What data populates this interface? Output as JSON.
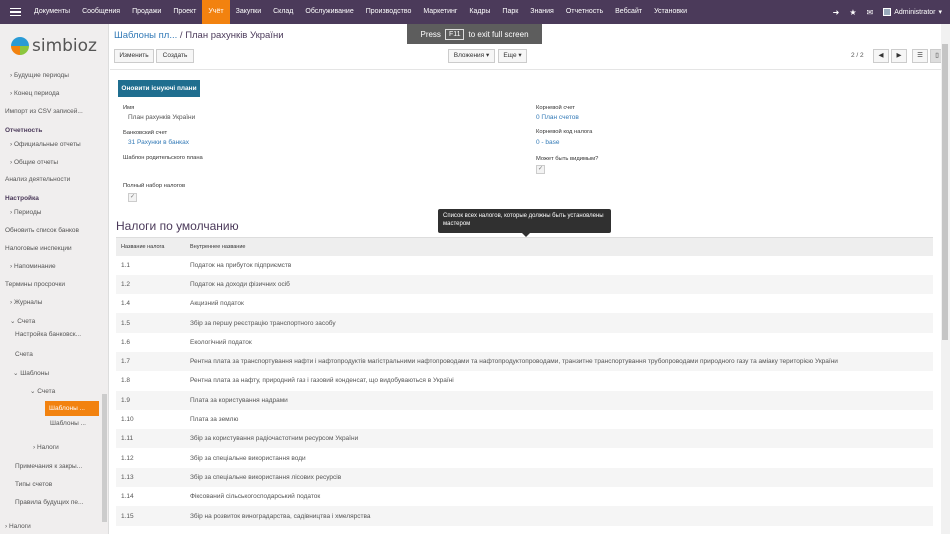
{
  "topbar": {
    "menu": [
      "Документы",
      "Сообщения",
      "Продажи",
      "Проект",
      "Учёт",
      "Закупки",
      "Склад",
      "Обслуживание",
      "Производство",
      "Маркетинг",
      "Кадры",
      "Парк",
      "Знания",
      "Отчетность",
      "Вебсайт",
      "Установки"
    ],
    "active": "Учёт",
    "user": "Administrator"
  },
  "sidebar": {
    "logo_text": "simbioz",
    "items": [
      "Будущие периоды",
      "Конец периода",
      "Импорт из CSV записей...",
      "Отчетность",
      "Официальные отчеты",
      "Общие отчеты",
      "Анализ деятельности",
      "Настройка",
      "Периоды",
      "Обновить список банков",
      "Налоговые инспекции",
      "Напоминание",
      "Термины просрочки",
      "Журналы",
      "Счета",
      "Настройка банковск...",
      "Счета",
      "Шаблоны",
      "Счета",
      "Шаблоны ...",
      "Шаблоны ...",
      "Налоги",
      "Примечания к закры...",
      "Типы счетов",
      "Правила будущих пе...",
      "Налоги"
    ]
  },
  "breadcrumb": {
    "parent": "Шаблоны пл...",
    "sep": "/",
    "current": "План рахунків України"
  },
  "toolbar": {
    "edit": "Изменить",
    "create": "Создать",
    "attachments": "Вложения ▾",
    "more": "Еще ▾",
    "pager": "2 / 2"
  },
  "fullscreen": {
    "press": "Press",
    "key": "F11",
    "rest": "to exit full screen"
  },
  "form": {
    "update_button": "Оновити існуючі плани",
    "name_label": "Имя",
    "name_value": "План рахунків України",
    "bank_label": "Банковский счет",
    "bank_value": "31 Рахунки в банках",
    "parent_label": "Шаблон родительского плана",
    "full_tax_label": "Полный набор налогов",
    "root_label": "Корневой счет",
    "root_value": "0 План счетов",
    "root_tax_label": "Корневой код налога",
    "root_tax_value": "0 - base",
    "visible_label": "Может быть видимым?"
  },
  "section_title": "Налоги по умолчанию",
  "tooltip": "Список всех налогов, которые должны быть установлены мастером",
  "table": {
    "headers": [
      "Название налога",
      "Внутреннее название"
    ],
    "rows": [
      [
        "1.1",
        "Податок на прибуток підприємств"
      ],
      [
        "1.2",
        "Податок на доходи фізичних осіб"
      ],
      [
        "1.4",
        "Акцизний податок"
      ],
      [
        "1.5",
        "Збір за першу реєстрацію транспортного засобу"
      ],
      [
        "1.6",
        "Екологічний податок"
      ],
      [
        "1.7",
        "Рентна плата за транспортування нафти і нафтопродуктів магістральними нафтопроводами та нафтопродуктопроводами, транзитне транспортування трубопроводами природного газу та аміаку територією України"
      ],
      [
        "1.8",
        "Рентна плата за нафту, природний газ і газовий конденсат, що видобуваються в Україні"
      ],
      [
        "1.9",
        "Плата за користування надрами"
      ],
      [
        "1.10",
        "Плата за землю"
      ],
      [
        "1.11",
        "Збір за користування радіочастотним ресурсом України"
      ],
      [
        "1.12",
        "Збір за спеціальне використання води"
      ],
      [
        "1.13",
        "Збір за спеціальне використання лісових ресурсів"
      ],
      [
        "1.14",
        "Фіксований сільськогосподарський податок"
      ],
      [
        "1.15",
        "Збір на розвиток виноградарства, садівництва і хмелярства"
      ]
    ]
  }
}
